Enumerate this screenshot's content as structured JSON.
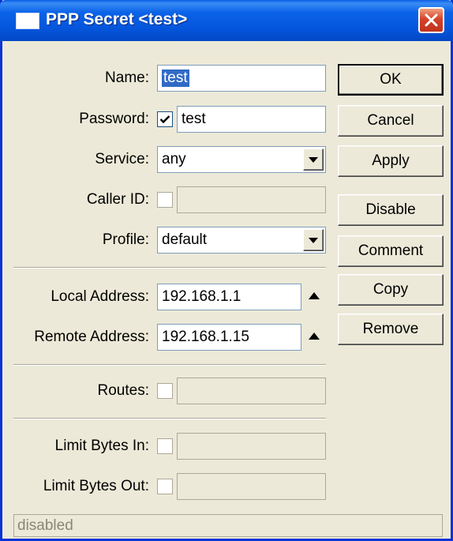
{
  "window": {
    "title": "PPP Secret <test>"
  },
  "form": {
    "name": {
      "label": "Name:",
      "value": "test"
    },
    "password": {
      "label": "Password:",
      "value": "test",
      "checked": true
    },
    "service": {
      "label": "Service:",
      "value": "any"
    },
    "caller_id": {
      "label": "Caller ID:",
      "value": "",
      "checked": false
    },
    "profile": {
      "label": "Profile:",
      "value": "default"
    },
    "local_address": {
      "label": "Local Address:",
      "value": "192.168.1.1"
    },
    "remote_address": {
      "label": "Remote Address:",
      "value": "192.168.1.15"
    },
    "routes": {
      "label": "Routes:",
      "value": "",
      "checked": false
    },
    "limit_bytes_in": {
      "label": "Limit Bytes In:",
      "value": "",
      "checked": false
    },
    "limit_bytes_out": {
      "label": "Limit Bytes Out:",
      "value": "",
      "checked": false
    }
  },
  "buttons": {
    "ok": "OK",
    "cancel": "Cancel",
    "apply": "Apply",
    "disable": "Disable",
    "comment": "Comment",
    "copy": "Copy",
    "remove": "Remove"
  },
  "status": "disabled",
  "colors": {
    "titlebar": "#0455dc",
    "face": "#ece9d8",
    "selection": "#316ac5",
    "close": "#d4432a"
  },
  "icons": {
    "window": "window-icon",
    "close": "close-x-icon",
    "dropdown": "dropdown-arrow-icon",
    "check": "checkmark-icon",
    "expand": "up-triangle-icon"
  }
}
